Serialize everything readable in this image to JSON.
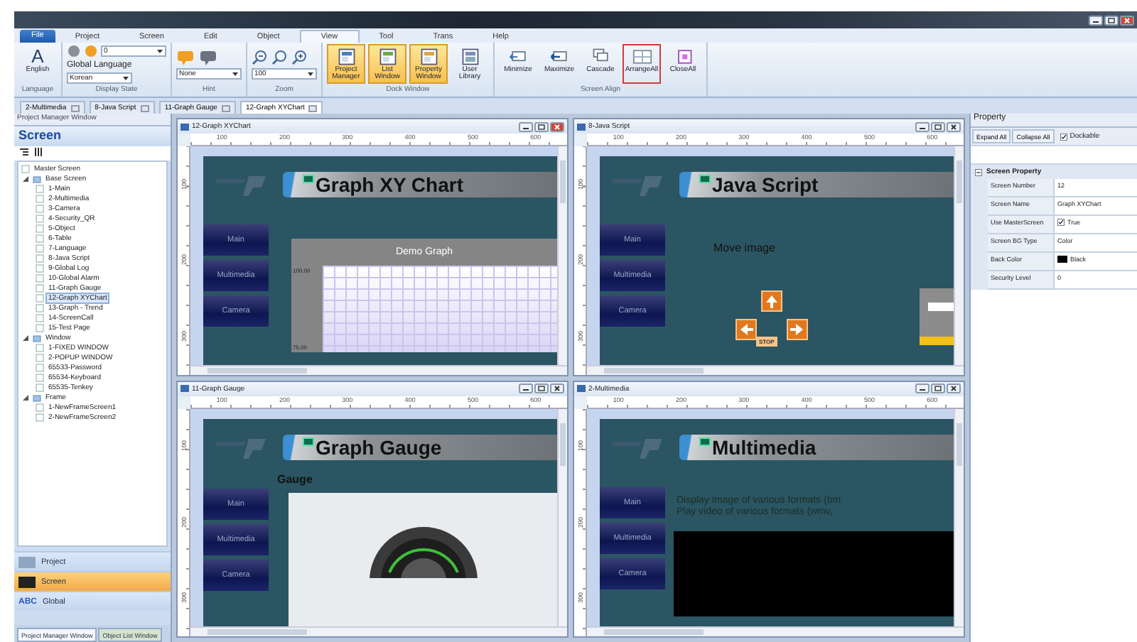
{
  "menu": [
    {
      "label": "File",
      "kind": "app",
      "selected": false
    },
    {
      "label": "Project",
      "kind": "tab",
      "selected": false
    },
    {
      "label": "Screen",
      "kind": "tab",
      "selected": false
    },
    {
      "label": "Edit",
      "kind": "tab",
      "selected": false
    },
    {
      "label": "Object",
      "kind": "tab",
      "selected": false
    },
    {
      "label": "View",
      "kind": "tab",
      "selected": true
    },
    {
      "label": "Tool",
      "kind": "tab",
      "selected": false
    },
    {
      "label": "Trans",
      "kind": "tab",
      "selected": false
    },
    {
      "label": "Help",
      "kind": "tab",
      "selected": false
    }
  ],
  "ribbon": [
    {
      "label": "Language",
      "items": [
        {
          "kind": "big",
          "label": "English",
          "glyph": "A",
          "highlighted": false,
          "focused": false
        }
      ]
    },
    {
      "label": "Display State",
      "items": [
        {
          "kind": "combo",
          "value": "0",
          "prefix_icons": true
        },
        {
          "kind": "label",
          "text": "Global Language"
        },
        {
          "kind": "combo",
          "value": "Korean",
          "prefix_icons": false
        }
      ]
    },
    {
      "label": "Hint",
      "items": [
        {
          "kind": "icon-row"
        },
        {
          "kind": "combo",
          "value": "None",
          "prefix_icons": false
        }
      ]
    },
    {
      "label": "Zoom",
      "items": [
        {
          "kind": "icon-row"
        },
        {
          "kind": "combo",
          "value": "100",
          "prefix_icons": false
        }
      ]
    },
    {
      "label": "Dock Window",
      "items": [
        {
          "kind": "big",
          "label": "Project Manager",
          "highlighted": true,
          "focused": false
        },
        {
          "kind": "big",
          "label": "List Window",
          "highlighted": true,
          "focused": false
        },
        {
          "kind": "big",
          "label": "Property Window",
          "highlighted": true,
          "focused": false
        },
        {
          "kind": "big",
          "label": "User Library",
          "highlighted": false,
          "focused": false
        }
      ]
    },
    {
      "label": "Screen Align",
      "items": [
        {
          "kind": "big",
          "label": "Minimize",
          "highlighted": false,
          "focused": false
        },
        {
          "kind": "big",
          "label": "Maximize",
          "highlighted": false,
          "focused": false
        },
        {
          "kind": "big",
          "label": "Cascade",
          "highlighted": false,
          "focused": false
        },
        {
          "kind": "big",
          "label": "ArrangeAll",
          "highlighted": false,
          "focused": true
        },
        {
          "kind": "big",
          "label": "CloseAll",
          "highlighted": false,
          "focused": false
        }
      ]
    }
  ],
  "doc_tabs": [
    {
      "label": "2-Multimedia",
      "selected": false
    },
    {
      "label": "8-Java Script",
      "selected": false
    },
    {
      "label": "11-Graph Gauge",
      "selected": false
    },
    {
      "label": "12-Graph XYChart",
      "selected": true
    }
  ],
  "project_manager": {
    "title": "Project Manager Window",
    "header": "Screen",
    "tree": [
      {
        "label": "Master Screen",
        "selected": false
      },
      {
        "label": "Base Screen",
        "selected": false,
        "expanded": true,
        "children": [
          {
            "label": "1-Main",
            "selected": false
          },
          {
            "label": "2-Multimedia",
            "selected": false
          },
          {
            "label": "3-Camera",
            "selected": false
          },
          {
            "label": "4-Security_QR",
            "selected": false
          },
          {
            "label": "5-Object",
            "selected": false
          },
          {
            "label": "6-Table",
            "selected": false
          },
          {
            "label": "7-Language",
            "selected": false
          },
          {
            "label": "8-Java Script",
            "selected": false
          },
          {
            "label": "9-Global Log",
            "selected": false
          },
          {
            "label": "10-Global Alarm",
            "selected": false
          },
          {
            "label": "11-Graph Gauge",
            "selected": false
          },
          {
            "label": "12-Graph XYChart",
            "selected": true
          },
          {
            "label": "13-Graph - Trend",
            "selected": false
          },
          {
            "label": "14-ScreenCall",
            "selected": false
          },
          {
            "label": "15-Test Page",
            "selected": false
          }
        ]
      },
      {
        "label": "Window",
        "selected": false,
        "expanded": true,
        "children": [
          {
            "label": "1-FIXED WINDOW",
            "selected": false
          },
          {
            "label": "2-POPUP WINDOW",
            "selected": false
          },
          {
            "label": "65533-Password",
            "selected": false
          },
          {
            "label": "65534-Keyboard",
            "selected": false
          },
          {
            "label": "65535-Tenkey",
            "selected": false
          }
        ]
      },
      {
        "label": "Frame",
        "selected": false,
        "expanded": true,
        "children": [
          {
            "label": "1-NewFrameScreen1",
            "selected": false
          },
          {
            "label": "2-NewFrameScreen2",
            "selected": false
          }
        ]
      }
    ],
    "nav": [
      {
        "label": "Project",
        "selected": false
      },
      {
        "label": "Screen",
        "selected": true
      },
      {
        "label": "Global",
        "selected": false,
        "badge": "ABC"
      }
    ],
    "bottom_tabs": [
      {
        "label": "Project Manager Window",
        "selected": true
      },
      {
        "label": "Object List Window",
        "selected": false
      }
    ]
  },
  "windows": [
    {
      "title": "12-Graph XYChart",
      "active": true,
      "kind": "xychart",
      "banner": "Graph XY Chart",
      "ruler": [
        "100",
        "200",
        "300",
        "400",
        "500",
        "600"
      ],
      "vruler": [
        "100",
        "200",
        "300"
      ],
      "side_buttons": [
        "Main",
        "Multimedia",
        "Camera"
      ],
      "graph_title": "Demo Graph",
      "y_labels": [
        "100.00",
        "75.00"
      ]
    },
    {
      "title": "8-Java Script",
      "active": false,
      "kind": "javascript",
      "banner": "Java Script",
      "ruler": [
        "100",
        "200",
        "300",
        "400",
        "500",
        "600"
      ],
      "vruler": [
        "100",
        "200",
        "300"
      ],
      "side_buttons": [
        "Main",
        "Multimedia",
        "Camera"
      ],
      "caption": "Move image",
      "stop_label": "STOP"
    },
    {
      "title": "11-Graph Gauge",
      "active": false,
      "kind": "gauge",
      "banner": "Graph Gauge",
      "ruler": [
        "100",
        "200",
        "300",
        "400",
        "500",
        "600"
      ],
      "vruler": [
        "100",
        "200",
        "300"
      ],
      "side_buttons": [
        "Main",
        "Multimedia",
        "Camera"
      ],
      "caption": "Gauge"
    },
    {
      "title": "2-Multimedia",
      "active": false,
      "kind": "multimedia",
      "banner": "Multimedia",
      "ruler": [
        "100",
        "200",
        "300",
        "400",
        "500",
        "600"
      ],
      "vruler": [
        "100",
        "200",
        "300"
      ],
      "side_buttons": [
        "Main",
        "Multimedia",
        "Camera"
      ],
      "lines": [
        "Display image of various formats (bm",
        "Play video of various formats (wmv,"
      ]
    }
  ],
  "property": {
    "title": "Property",
    "buttons": [
      "Expand All",
      "Collapse All"
    ],
    "dockable": {
      "label": "Dockable",
      "checked": true
    },
    "section": {
      "title": "Screen Property",
      "expanded": true
    },
    "rows": [
      {
        "name": "Screen Number",
        "kind": "text",
        "value": "12"
      },
      {
        "name": "Screen Name",
        "kind": "text",
        "value": "Graph XYChart"
      },
      {
        "name": "Use MasterScreen",
        "kind": "check",
        "value": "True",
        "checked": true
      },
      {
        "name": "Screen BG Type",
        "kind": "text",
        "value": "Color"
      },
      {
        "name": "Back Color",
        "kind": "color",
        "value": "Black",
        "color": "#000000"
      },
      {
        "name": "Security Level",
        "kind": "text",
        "value": "0"
      }
    ]
  }
}
